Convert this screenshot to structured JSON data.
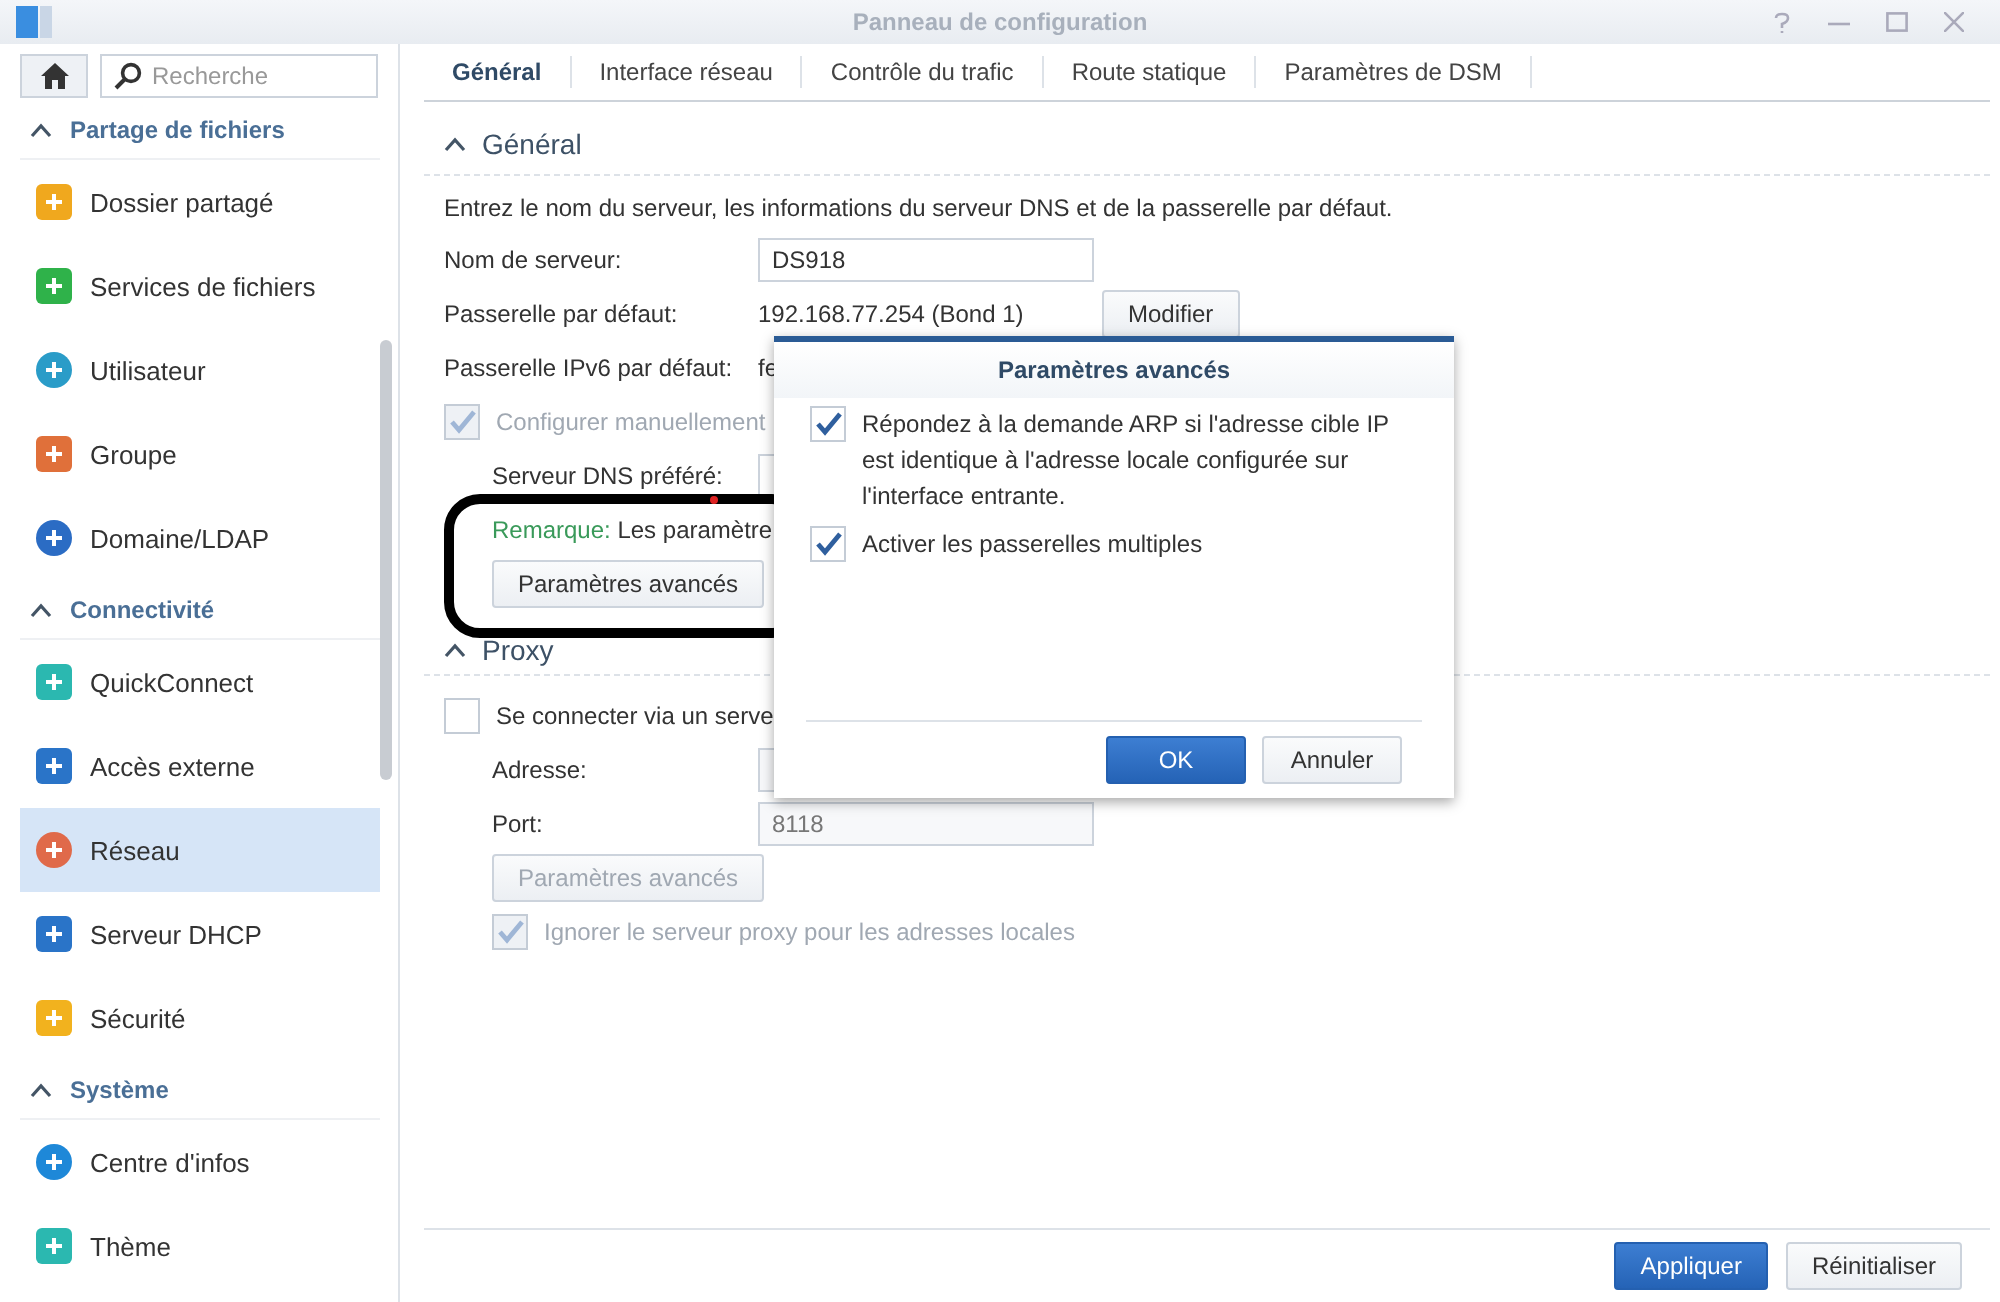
{
  "window": {
    "title": "Panneau de configuration"
  },
  "sidebar": {
    "search": {
      "placeholder": "Recherche"
    },
    "groups": [
      {
        "title": "Partage de fichiers",
        "expanded": true,
        "items": [
          {
            "label": "Dossier partagé",
            "selected": false
          },
          {
            "label": "Services de fichiers",
            "selected": false
          },
          {
            "label": "Utilisateur",
            "selected": false
          },
          {
            "label": "Groupe",
            "selected": false
          },
          {
            "label": "Domaine/LDAP",
            "selected": false
          }
        ]
      },
      {
        "title": "Connectivité",
        "expanded": true,
        "items": [
          {
            "label": "QuickConnect",
            "selected": false
          },
          {
            "label": "Accès externe",
            "selected": false
          },
          {
            "label": "Réseau",
            "selected": true
          },
          {
            "label": "Serveur DHCP",
            "selected": false
          },
          {
            "label": "Sécurité",
            "selected": false
          }
        ]
      },
      {
        "title": "Système",
        "expanded": true,
        "items": [
          {
            "label": "Centre d'infos",
            "selected": false
          },
          {
            "label": "Thème",
            "selected": false
          }
        ]
      }
    ]
  },
  "tabs": [
    {
      "label": "Général",
      "selected": true
    },
    {
      "label": "Interface réseau",
      "selected": false
    },
    {
      "label": "Contrôle du trafic",
      "selected": false
    },
    {
      "label": "Route statique",
      "selected": false
    },
    {
      "label": "Paramètres de DSM",
      "selected": false
    }
  ],
  "general": {
    "title": "Général",
    "expanded": true,
    "description": "Entrez le nom du serveur, les informations du serveur DNS et de la passerelle par défaut.",
    "server_name": {
      "label": "Nom de serveur:",
      "value": "DS918"
    },
    "gateway": {
      "label": "Passerelle par défaut:",
      "value": "192.168.77.254 (Bond 1)",
      "button": "Modifier"
    },
    "ipv6_gateway": {
      "label": "Passerelle IPv6 par défaut:",
      "value": "fe"
    },
    "manual_dns": {
      "label": "Configurer manuellement",
      "checked": true,
      "disabled": true
    },
    "preferred_dns": {
      "label": "Serveur DNS préféré:"
    },
    "note": {
      "label": "Remarque:",
      "text": "Les paramètre"
    },
    "advanced_button": {
      "label": "Paramètres avancés"
    }
  },
  "proxy": {
    "title": "Proxy",
    "expanded": true,
    "use_proxy": {
      "label": "Se connecter via un serve",
      "checked": false
    },
    "address": {
      "label": "Adresse:",
      "disabled": true
    },
    "port": {
      "label": "Port:",
      "value": "8118",
      "disabled": true
    },
    "advanced_button": {
      "label": "Paramètres avancés",
      "disabled": true
    },
    "bypass_local": {
      "label": "Ignorer le serveur proxy pour les adresses locales",
      "checked": true,
      "disabled": true
    }
  },
  "dialog": {
    "title": "Paramètres avancés",
    "options": [
      {
        "label": "Répondez à la demande ARP si l'adresse cible IP est identique à l'adresse locale configurée sur l'interface entrante.",
        "checked": true
      },
      {
        "label": "Activer les passerelles multiples",
        "checked": true
      }
    ],
    "buttons": [
      {
        "label": "OK",
        "kind": "primary"
      },
      {
        "label": "Annuler",
        "kind": "secondary"
      }
    ]
  },
  "footer": {
    "buttons": [
      {
        "label": "Appliquer",
        "kind": "primary"
      },
      {
        "label": "Réinitialiser",
        "kind": "secondary"
      }
    ]
  }
}
